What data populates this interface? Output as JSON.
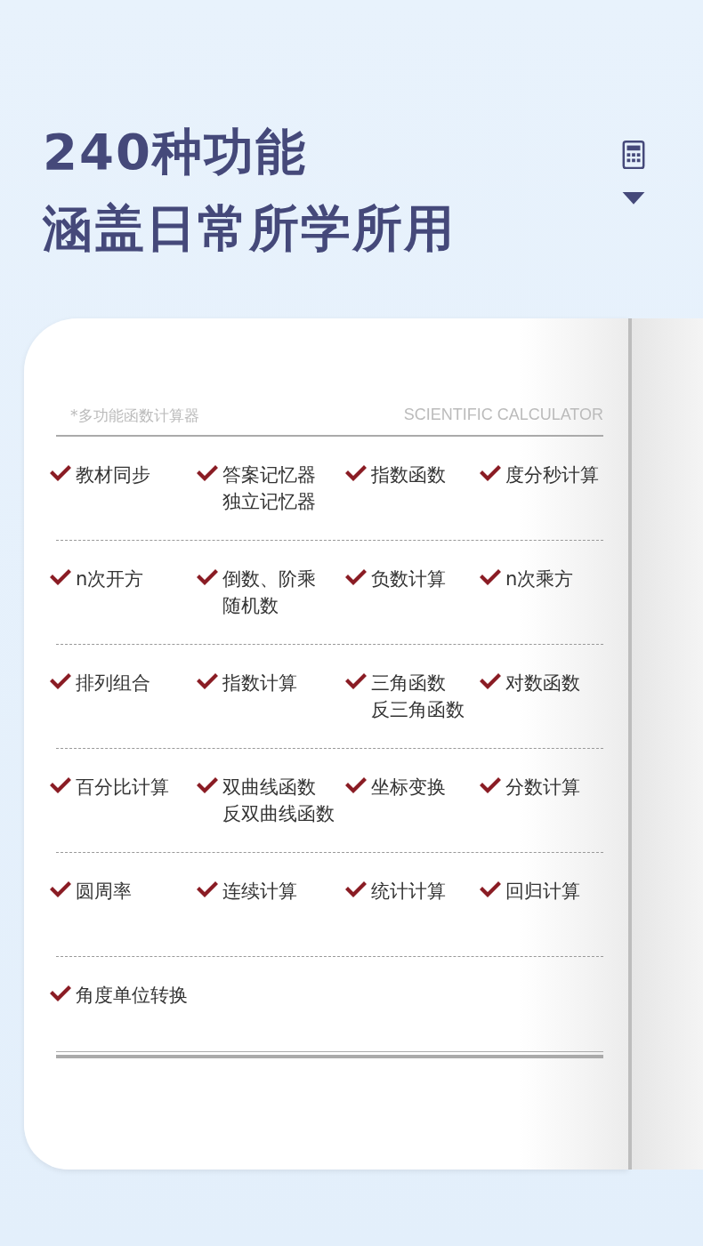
{
  "headline": [
    "240种功能",
    "涵盖日常所学所用"
  ],
  "card": {
    "subtitle": "*多功能函数计算器",
    "subtitle_en": "SCIENTIFIC CALCULATOR",
    "rows": [
      [
        {
          "lines": [
            "教材同步"
          ]
        },
        {
          "lines": [
            "答案记忆器",
            "独立记忆器"
          ]
        },
        {
          "lines": [
            "指数函数"
          ]
        },
        {
          "lines": [
            "度分秒计算"
          ]
        }
      ],
      [
        {
          "lines": [
            "n次开方"
          ]
        },
        {
          "lines": [
            "倒数、阶乘",
            "随机数"
          ]
        },
        {
          "lines": [
            "负数计算"
          ]
        },
        {
          "lines": [
            "n次乘方"
          ]
        }
      ],
      [
        {
          "lines": [
            "排列组合"
          ]
        },
        {
          "lines": [
            "指数计算"
          ]
        },
        {
          "lines": [
            "三角函数",
            "反三角函数"
          ]
        },
        {
          "lines": [
            "对数函数"
          ]
        }
      ],
      [
        {
          "lines": [
            "百分比计算"
          ]
        },
        {
          "lines": [
            "双曲线函数",
            "反双曲线函数"
          ]
        },
        {
          "lines": [
            "坐标变换"
          ]
        },
        {
          "lines": [
            "分数计算"
          ]
        }
      ],
      [
        {
          "lines": [
            "圆周率"
          ]
        },
        {
          "lines": [
            "连续计算"
          ]
        },
        {
          "lines": [
            "统计计算"
          ]
        },
        {
          "lines": [
            "回归计算"
          ]
        }
      ],
      [
        {
          "lines": [
            "角度单位转换"
          ]
        }
      ]
    ]
  }
}
